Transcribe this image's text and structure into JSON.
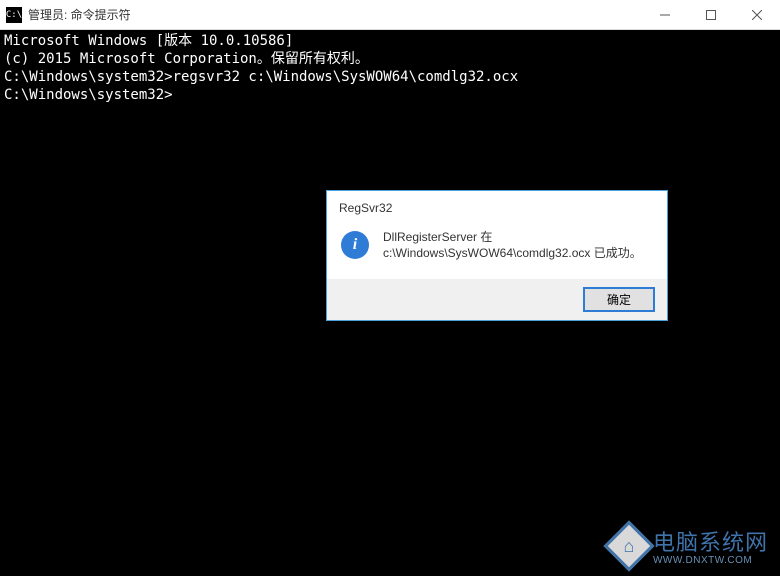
{
  "titlebar": {
    "icon_text": "C:\\",
    "title": "管理员: 命令提示符"
  },
  "console": {
    "line1": "Microsoft Windows [版本 10.0.10586]",
    "line2": "(c) 2015 Microsoft Corporation。保留所有权利。",
    "blank1": "",
    "line3": "C:\\Windows\\system32>regsvr32 c:\\Windows\\SysWOW64\\comdlg32.ocx",
    "blank2": "",
    "line4": "C:\\Windows\\system32>"
  },
  "dialog": {
    "title": "RegSvr32",
    "msg_line1": "DllRegisterServer 在",
    "msg_line2": "c:\\Windows\\SysWOW64\\comdlg32.ocx 已成功。",
    "ok_label": "确定",
    "info_glyph": "i"
  },
  "watermark": {
    "icon_glyph": "⌂",
    "text_cn": "电脑系统网",
    "url": "WWW.DNXTW.COM"
  }
}
